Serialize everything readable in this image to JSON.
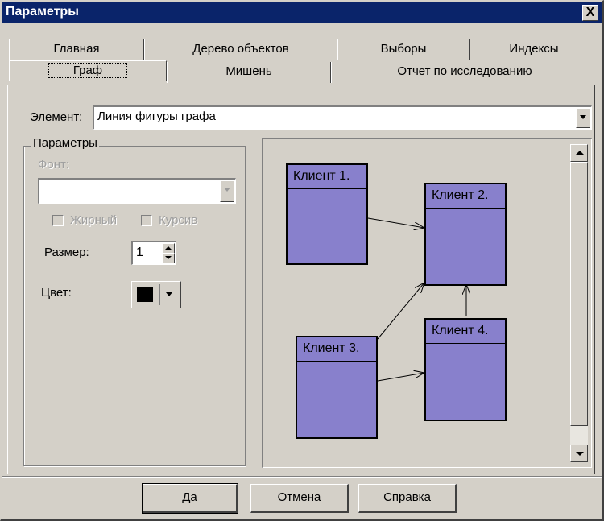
{
  "window": {
    "title": "Параметры",
    "close_label": "X"
  },
  "tabs_row1": [
    {
      "label": "Главная"
    },
    {
      "label": "Дерево объектов"
    },
    {
      "label": "Выборы"
    },
    {
      "label": "Индексы"
    }
  ],
  "tabs_row2": [
    {
      "label": "Граф",
      "selected": true
    },
    {
      "label": "Мишень"
    },
    {
      "label": "Отчет по исследованию"
    }
  ],
  "element": {
    "label": "Элемент:",
    "value": "Линия фигуры графа"
  },
  "params": {
    "group_title": "Параметры",
    "font_label": "Фонт:",
    "font_value": "",
    "bold_label": "Жирный",
    "italic_label": "Курсив",
    "size_label": "Размер:",
    "size_value": "1",
    "color_label": "Цвет:",
    "color_value": "#000000"
  },
  "graph": {
    "node_color": "#8880cc",
    "nodes": [
      {
        "id": "n1",
        "label": "Клиент 1."
      },
      {
        "id": "n2",
        "label": "Клиент 2."
      },
      {
        "id": "n3",
        "label": "Клиент 3."
      },
      {
        "id": "n4",
        "label": "Клиент 4."
      }
    ],
    "edges": [
      {
        "from": "Клиент 1.",
        "to": "Клиент 2."
      },
      {
        "from": "Клиент 3.",
        "to": "Клиент 2."
      },
      {
        "from": "Клиент 3.",
        "to": "Клиент 4."
      },
      {
        "from": "Клиент 4.",
        "to": "Клиент 2."
      }
    ]
  },
  "buttons": {
    "ok": "Да",
    "cancel": "Отмена",
    "help": "Справка"
  }
}
